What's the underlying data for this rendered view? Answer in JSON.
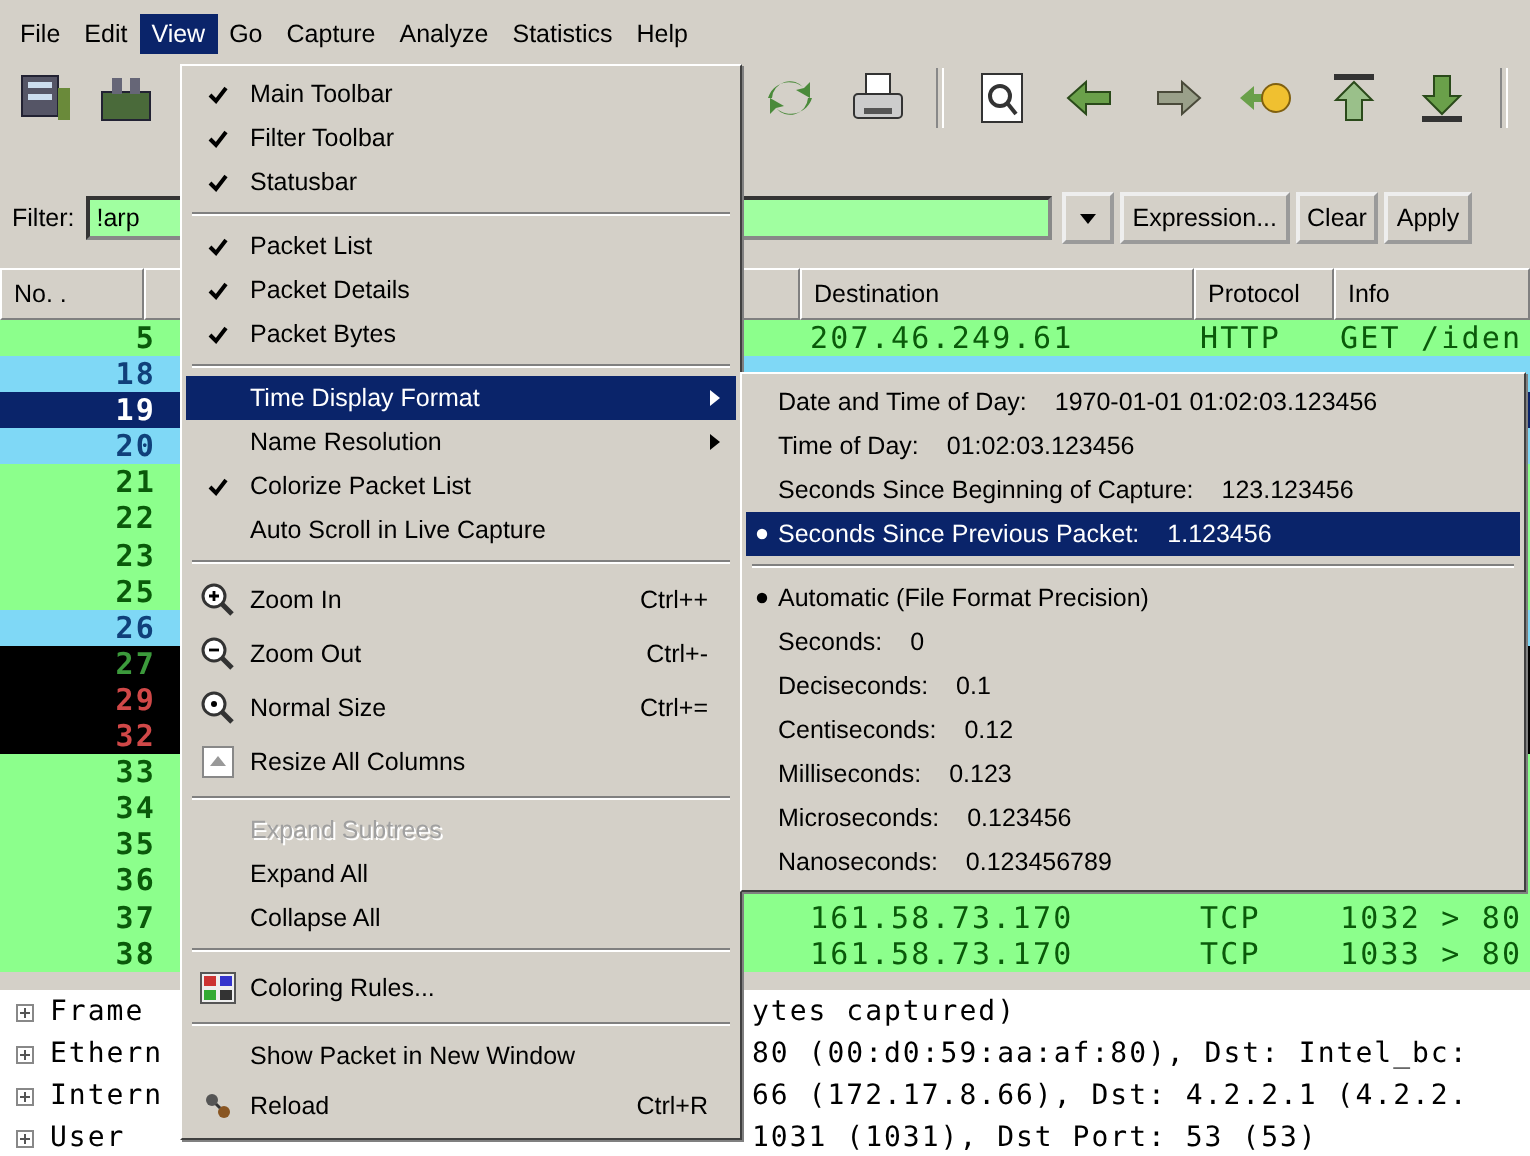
{
  "menu_bar": [
    {
      "label": "File",
      "selected": false
    },
    {
      "label": "Edit",
      "selected": false
    },
    {
      "label": "View",
      "selected": true
    },
    {
      "label": "Go",
      "selected": false
    },
    {
      "label": "Capture",
      "selected": false
    },
    {
      "label": "Analyze",
      "selected": false
    },
    {
      "label": "Statistics",
      "selected": false
    },
    {
      "label": "Help",
      "selected": false
    }
  ],
  "filter_bar": {
    "label": "Filter:",
    "value": "!arp",
    "buttons": [
      "Expression...",
      "Clear",
      "Apply"
    ]
  },
  "packet_list": {
    "columns": [
      "No. .",
      "Destination",
      "Protocol",
      "Info"
    ],
    "rows": [
      {
        "no": {
          "text": "5",
          "color": "#0a5a0a"
        },
        "destination": "207.46.249.61",
        "protocol": "HTTP",
        "info": "GET /iden",
        "color": "#8cff8c",
        "selected": false
      },
      {
        "no": {
          "text": "18",
          "color": "#10407a"
        },
        "color": "#7fd8f6",
        "selected": false
      },
      {
        "no": {
          "text": "19"
        },
        "selected": true
      },
      {
        "no": {
          "text": "20",
          "color": "#10407a"
        },
        "color": "#7fd8f6",
        "selected": false
      },
      {
        "no": {
          "text": "21",
          "color": "#0a5a0a"
        },
        "color": "#8cff8c",
        "selected": false
      },
      {
        "no": {
          "text": "22",
          "color": "#0a5a0a"
        },
        "color": "#8cff8c",
        "selected": false
      },
      {
        "no": {
          "text": "23",
          "color": "#0a5a0a"
        },
        "color": "#8cff8c",
        "selected": false
      },
      {
        "no": {
          "text": "25",
          "color": "#0a5a0a"
        },
        "color": "#8cff8c",
        "selected": false
      },
      {
        "no": {
          "text": "26",
          "color": "#10407a"
        },
        "color": "#7fd8f6",
        "selected": false
      },
      {
        "no": {
          "text": "27",
          "color": "#3c9a3c"
        },
        "color": "#000000",
        "selected": false
      },
      {
        "no": {
          "text": "29",
          "color": "#d04848"
        },
        "color": "#000000",
        "selected": false
      },
      {
        "no": {
          "text": "32",
          "color": "#d04848"
        },
        "color": "#000000",
        "selected": false
      },
      {
        "no": {
          "text": "33",
          "color": "#0a5a0a"
        },
        "color": "#8cff8c",
        "selected": false
      },
      {
        "no": {
          "text": "34",
          "color": "#0a5a0a"
        },
        "color": "#8cff8c",
        "selected": false
      },
      {
        "no": {
          "text": "35",
          "color": "#0a5a0a"
        },
        "color": "#8cff8c",
        "selected": false
      },
      {
        "no": {
          "text": "36",
          "color": "#0a5a0a"
        },
        "color": "#8cff8c",
        "selected": false
      },
      {
        "no": {
          "text": "37",
          "color": "#0a5a0a"
        },
        "destination": "161.58.73.170",
        "protocol": "TCP",
        "info": "1032 > 80",
        "color": "#8cff8c",
        "selected": false
      },
      {
        "no": {
          "text": "38",
          "color": "#0a5a0a"
        },
        "destination": "161.58.73.170",
        "protocol": "TCP",
        "info": "1033 > 80",
        "color": "#8cff8c",
        "selected": false
      }
    ]
  },
  "packet_details": [
    {
      "left": "Frame",
      "right": "ytes captured)"
    },
    {
      "left": "Ethern",
      "right": "80 (00:d0:59:aa:af:80), Dst: Intel_bc:"
    },
    {
      "left": "Intern",
      "right": "66 (172.17.8.66), Dst: 4.2.2.1 (4.2.2."
    },
    {
      "left": "User",
      "right": "1031 (1031), Dst Port: 53 (53)"
    }
  ],
  "view_menu": [
    {
      "kind": "check",
      "label": "Main Toolbar",
      "checked": true,
      "selected": false,
      "disabled": false
    },
    {
      "kind": "check",
      "label": "Filter Toolbar",
      "checked": true,
      "selected": false,
      "disabled": false
    },
    {
      "kind": "check",
      "label": "Statusbar",
      "checked": true,
      "selected": false,
      "disabled": false
    },
    {
      "kind": "separator"
    },
    {
      "kind": "check",
      "label": "Packet List",
      "checked": true,
      "selected": false,
      "disabled": false
    },
    {
      "kind": "check",
      "label": "Packet Details",
      "checked": true,
      "selected": false,
      "disabled": false
    },
    {
      "kind": "check",
      "label": "Packet Bytes",
      "checked": true,
      "selected": false,
      "disabled": false
    },
    {
      "kind": "separator"
    },
    {
      "kind": "submenu",
      "label": "Time Display Format",
      "selected": true,
      "disabled": false
    },
    {
      "kind": "submenu",
      "label": "Name Resolution",
      "selected": false,
      "disabled": false
    },
    {
      "kind": "check",
      "label": "Colorize Packet List",
      "checked": true,
      "selected": false,
      "disabled": false
    },
    {
      "kind": "check",
      "label": "Auto Scroll in Live Capture",
      "checked": false,
      "selected": false,
      "disabled": false
    },
    {
      "kind": "separator"
    },
    {
      "kind": "icon",
      "label": "Zoom In",
      "shortcut": "Ctrl++",
      "selected": false,
      "disabled": false
    },
    {
      "kind": "icon",
      "label": "Zoom Out",
      "shortcut": "Ctrl+-",
      "selected": false,
      "disabled": false
    },
    {
      "kind": "icon",
      "label": "Normal Size",
      "shortcut": "Ctrl+=",
      "selected": false,
      "disabled": false
    },
    {
      "kind": "icon",
      "label": "Resize All Columns",
      "selected": false,
      "disabled": false
    },
    {
      "kind": "separator"
    },
    {
      "kind": "plain",
      "label": "Expand Subtrees",
      "selected": false,
      "disabled": true
    },
    {
      "kind": "plain",
      "label": "Expand All",
      "selected": false,
      "disabled": false
    },
    {
      "kind": "plain",
      "label": "Collapse All",
      "selected": false,
      "disabled": false
    },
    {
      "kind": "separator"
    },
    {
      "kind": "icon",
      "label": "Coloring Rules...",
      "selected": false,
      "disabled": false
    },
    {
      "kind": "separator"
    },
    {
      "kind": "plain",
      "label": "Show Packet in New Window",
      "selected": false,
      "disabled": false
    },
    {
      "kind": "icon",
      "label": "Reload",
      "shortcut": "Ctrl+R",
      "selected": false,
      "disabled": false
    }
  ],
  "time_format_menu": [
    {
      "kind": "radio",
      "label": "Date and Time of Day:",
      "value": "1970-01-01 01:02:03.123456",
      "checked": false,
      "selected": false
    },
    {
      "kind": "radio",
      "label": "Time of Day:",
      "value": "01:02:03.123456",
      "checked": false,
      "selected": false
    },
    {
      "kind": "radio",
      "label": "Seconds Since Beginning of Capture:",
      "value": "123.123456",
      "checked": false,
      "selected": false
    },
    {
      "kind": "radio",
      "label": "Seconds Since Previous Packet:",
      "value": "1.123456",
      "checked": true,
      "selected": true
    },
    {
      "kind": "separator"
    },
    {
      "kind": "radio",
      "label": "Automatic (File Format Precision)",
      "checked": true,
      "selected": false
    },
    {
      "kind": "radio",
      "label": "Seconds:",
      "value": "0",
      "checked": false,
      "selected": false
    },
    {
      "kind": "radio",
      "label": "Deciseconds:",
      "value": "0.1",
      "checked": false,
      "selected": false
    },
    {
      "kind": "radio",
      "label": "Centiseconds:",
      "value": "0.12",
      "checked": false,
      "selected": false
    },
    {
      "kind": "radio",
      "label": "Milliseconds:",
      "value": "0.123",
      "checked": false,
      "selected": false
    },
    {
      "kind": "radio",
      "label": "Microseconds:",
      "value": "0.123456",
      "checked": false,
      "selected": false
    },
    {
      "kind": "radio",
      "label": "Nanoseconds:",
      "value": "0.123456789",
      "checked": false,
      "selected": false
    }
  ]
}
